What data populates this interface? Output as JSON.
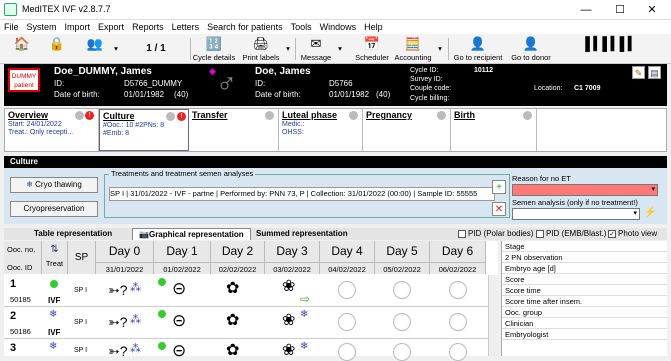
{
  "window": {
    "title": "MedITEX IVF v2.8.7.7",
    "min": "—",
    "max": "☐",
    "close": "✕"
  },
  "menu": [
    "File",
    "System",
    "Import",
    "Export",
    "Reports",
    "Letters",
    "Search for patients",
    "Tools",
    "Windows",
    "Help"
  ],
  "toolbar": {
    "nav": "1 / 1",
    "cycle_details": "Cycle details",
    "print_labels": "Print labels",
    "message": "Message",
    "scheduler": "Scheduler",
    "accounting": "Accounting",
    "to_recipient": "Go to recipient",
    "to_donor": "Go to donor"
  },
  "patient": {
    "badge": "DUMMY patient",
    "female_name": "Doe_DUMMY, James",
    "female_id_label": "ID:",
    "female_id": "D5766_DUMMY",
    "dob_label": "Date of birth:",
    "female_dob": "01/01/1982",
    "female_age": "(40)",
    "male_name": "Doe, James",
    "male_id": "D5766",
    "male_dob": "01/01/1982",
    "male_age": "(40)",
    "cycle_id_label": "Cycle ID:",
    "cycle_id": "10112",
    "survey_label": "Survey ID:",
    "couple_label": "Couple code:",
    "billing_label": "Cycle billing:",
    "location_label": "Location:",
    "location": "C1 7009"
  },
  "phases": {
    "overview": {
      "title": "Overview",
      "l1": "Start: 24/01/2022",
      "l2": "Treat.: Only recepti..."
    },
    "culture": {
      "title": "Culture",
      "l1": "#Ooc.: 10 #2PNs: 8",
      "l2": "#Emb: 8"
    },
    "transfer": {
      "title": "Transfer"
    },
    "luteal": {
      "title": "Luteal phase",
      "l1": "Medic.:",
      "l2": "OHSS:"
    },
    "pregnancy": {
      "title": "Pregnancy"
    },
    "birth": {
      "title": "Birth"
    }
  },
  "culture": {
    "header": "Culture",
    "cryo_thawing": "Cryo thawing",
    "cryopreservation": "Cryopreservation",
    "tx_legend": "Treatments and treatment semen analyses",
    "tx_row": "SP I | 31/01/2022 - IVF - partne | Performed by: PNN 73, P | Collection: 31/01/2022 (00:00) | Sample ID: 55555",
    "no_et_label": "Reason for no ET",
    "semen_label": "Semen analysis (only if no treatment!)"
  },
  "tabs": {
    "table": "Table representation",
    "graphical": "Graphical representation",
    "summed": "Summed representation",
    "pid_polar": "PID (Polar bodies)",
    "pid_emb": "PID (EMB/Blast.)",
    "photo": "Photo view"
  },
  "grid": {
    "ooc_no": "Ooc. no.",
    "ooc_id": "Ooc. ID",
    "treat": "Treat",
    "sp": "SP",
    "days": [
      {
        "d": "Day 0",
        "date": "31/01/2022"
      },
      {
        "d": "Day 1",
        "date": "01/02/2022"
      },
      {
        "d": "Day 2",
        "date": "02/02/2022"
      },
      {
        "d": "Day 3",
        "date": "03/02/2022"
      },
      {
        "d": "Day 4",
        "date": "04/02/2022"
      },
      {
        "d": "Day 5",
        "date": "05/02/2022"
      },
      {
        "d": "Day 6",
        "date": "06/02/2022"
      }
    ],
    "rows": [
      {
        "no": "1",
        "id": "50185",
        "treat": "IVF",
        "sp": "SP I"
      },
      {
        "no": "2",
        "id": "50186",
        "treat": "IVF",
        "sp": "SP I"
      },
      {
        "no": "3",
        "id": "",
        "treat": "",
        "sp": "SP I"
      }
    ]
  },
  "details": [
    "Stage",
    "2 PN observation",
    "Embryo age [d]",
    "Score",
    "Score time",
    "Score time after insem.",
    "Ooc. group",
    "Clinician",
    "Embryologist"
  ]
}
